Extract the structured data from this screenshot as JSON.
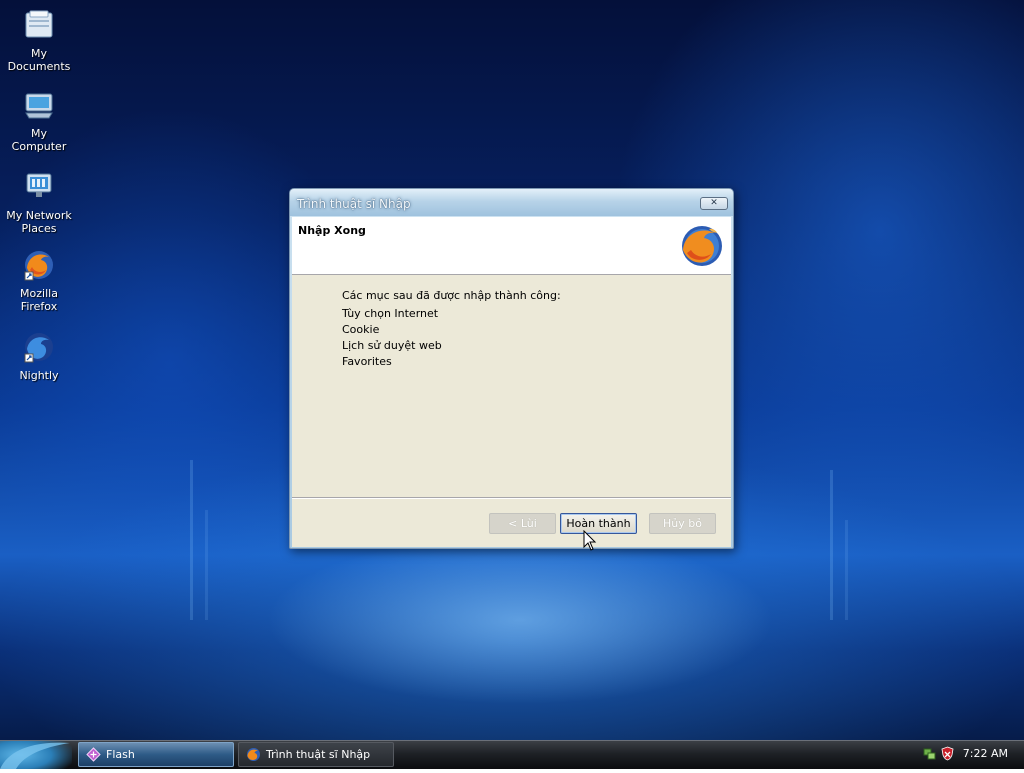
{
  "desktop": {
    "icons": [
      {
        "label_line1": "My",
        "label_line2": "Documents",
        "icon": "folder-documents-icon"
      },
      {
        "label_line1": "My",
        "label_line2": "Computer",
        "icon": "computer-icon"
      },
      {
        "label_line1": "My Network",
        "label_line2": "Places",
        "icon": "network-places-icon"
      },
      {
        "label_line1": "Mozilla",
        "label_line2": "Firefox",
        "icon": "firefox-icon"
      },
      {
        "label_line1": "Nightly",
        "label_line2": "",
        "icon": "nightly-icon"
      }
    ]
  },
  "dialog": {
    "title": "Trình thuật sĩ Nhập",
    "close_glyph": "✕",
    "header_title": "Nhập Xong",
    "intro": "Các mục sau đã được nhập thành công:",
    "items": [
      "Tùy chọn Internet",
      "Cookie",
      "Lịch sử duyệt web",
      "Favorites"
    ],
    "buttons": {
      "back": "< Lùi",
      "finish": "Hoàn thành",
      "cancel": "Hủy bỏ"
    }
  },
  "taskbar": {
    "tasks": [
      {
        "label": "Flash",
        "active": true
      },
      {
        "label": "Trình thuật sĩ Nhập",
        "active": false
      }
    ],
    "clock": "7:22 AM"
  },
  "colors": {
    "dialog_face": "#ece9d8",
    "title_bar": "#b7d3e8",
    "taskbar": "#1e2126",
    "desktop_blue": "#0a3a95"
  }
}
